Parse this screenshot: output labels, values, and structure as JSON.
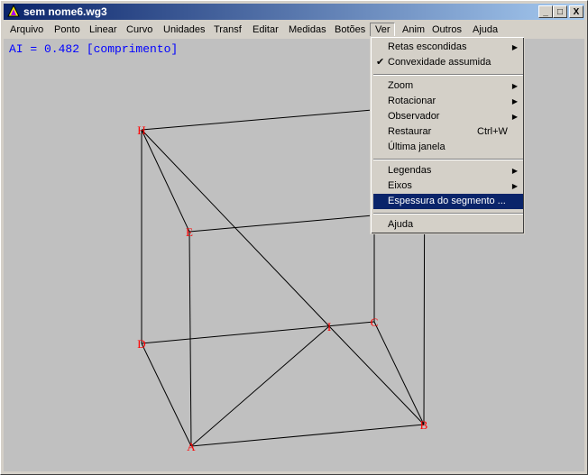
{
  "window": {
    "title": "sem nome6.wg3",
    "minimize": "_",
    "maximize": "□",
    "close": "X"
  },
  "menubar": [
    "Arquivo",
    "Ponto",
    "Linear",
    "Curvo",
    "Unidades",
    "Transf",
    "Editar",
    "Medidas",
    "Botões",
    "Ver",
    "Anim",
    "Outros",
    "Ajuda"
  ],
  "info": "AI = 0.482 [comprimento]",
  "menu": {
    "items": [
      {
        "label": "Retas escondidas",
        "submenu": true
      },
      {
        "label": "Convexidade assumida",
        "checked": true
      },
      {
        "label": "Zoom",
        "submenu": true
      },
      {
        "label": "Rotacionar",
        "submenu": true
      },
      {
        "label": "Observador",
        "submenu": true
      },
      {
        "label": "Restaurar",
        "shortcut": "Ctrl+W"
      },
      {
        "label": "Última janela"
      },
      {
        "label": "Legendas",
        "submenu": true
      },
      {
        "label": "Eixos",
        "submenu": true
      },
      {
        "label": "Espessura do segmento ...",
        "highlighted": true
      },
      {
        "label": "Ajuda"
      }
    ],
    "check": "✔",
    "arrow": "▶"
  },
  "points": {
    "H": "H",
    "E": "E",
    "D": "D",
    "A": "A",
    "B": "B",
    "C": "C",
    "I": "I"
  },
  "colors": {
    "labels": "#ff0000",
    "info": "#0000ff",
    "highlight": "#0a246a"
  }
}
